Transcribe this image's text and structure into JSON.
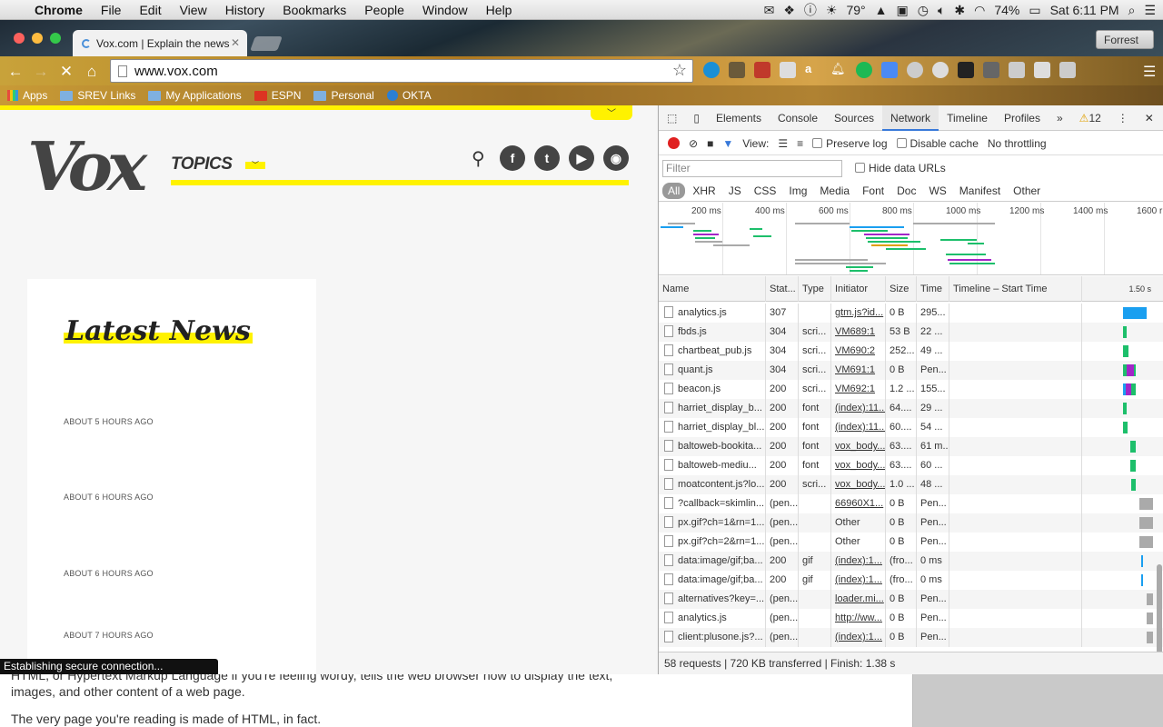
{
  "menubar": {
    "app": "Chrome",
    "items": [
      "File",
      "Edit",
      "View",
      "History",
      "Bookmarks",
      "People",
      "Window",
      "Help"
    ],
    "weather": "79°",
    "battery": "74%",
    "clock": "Sat 6:11 PM"
  },
  "browser": {
    "tab_title": "Vox.com | Explain the news",
    "url": "www.vox.com",
    "user": "Forrest",
    "bookmarks": [
      "Apps",
      "SREV Links",
      "My Applications",
      "ESPN",
      "Personal",
      "OKTA"
    ]
  },
  "page": {
    "logo": "Vox",
    "topics": "TOPICS",
    "latest_news": "Latest News",
    "timestamps": [
      "ABOUT 5 HOURS AGO",
      "ABOUT 6 HOURS AGO",
      "ABOUT 6 HOURS AGO",
      "ABOUT 7 HOURS AGO"
    ],
    "status": "Establishing secure connection...",
    "social": [
      "f",
      "t",
      "▶",
      "◉"
    ]
  },
  "background_doc": {
    "line1": "HTML, or Hypertext Markup Language if you're feeling wordy, tells the web browser how to display the text,",
    "line2": "images, and other content of a web page.",
    "line3": "The very page you're reading is made of HTML, in fact."
  },
  "devtools": {
    "tabs": [
      "Elements",
      "Console",
      "Sources",
      "Network",
      "Timeline",
      "Profiles"
    ],
    "active_tab": "Network",
    "warnings": "12",
    "view_label": "View:",
    "preserve_log": "Preserve log",
    "disable_cache": "Disable cache",
    "throttling": "No throttling",
    "filter_placeholder": "Filter",
    "hide_data_urls": "Hide data URLs",
    "filters": [
      "All",
      "XHR",
      "JS",
      "CSS",
      "Img",
      "Media",
      "Font",
      "Doc",
      "WS",
      "Manifest",
      "Other"
    ],
    "overview_labels": [
      "200 ms",
      "400 ms",
      "600 ms",
      "800 ms",
      "1000 ms",
      "1200 ms",
      "1400 ms",
      "1600 r"
    ],
    "columns": [
      "Name",
      "Stat...",
      "Type",
      "Initiator",
      "Size",
      "Time",
      "Timeline – Start Time"
    ],
    "timeline_scale": "1.50 s",
    "rows": [
      {
        "name": "analytics.js",
        "status": "307",
        "type": "",
        "initiator": "gtm.js?id...",
        "size": "0 B",
        "time": "295...",
        "wf": [
          {
            "s": 0.55,
            "w": 0.35,
            "c": "#1a9ff0"
          }
        ]
      },
      {
        "name": "fbds.js",
        "status": "304",
        "type": "scri...",
        "initiator": "VM689:1",
        "size": "53 B",
        "time": "22 ...",
        "wf": [
          {
            "s": 0.55,
            "w": 0.06,
            "c": "#1dbf6b"
          }
        ]
      },
      {
        "name": "chartbeat_pub.js",
        "status": "304",
        "type": "scri...",
        "initiator": "VM690:2",
        "size": "252...",
        "time": "49 ...",
        "wf": [
          {
            "s": 0.55,
            "w": 0.08,
            "c": "#1dbf6b"
          }
        ]
      },
      {
        "name": "quant.js",
        "status": "304",
        "type": "scri...",
        "initiator": "VM691:1",
        "size": "0 B",
        "time": "Pen...",
        "wf": [
          {
            "s": 0.55,
            "w": 0.06,
            "c": "#1dbf6b"
          },
          {
            "s": 0.61,
            "w": 0.1,
            "c": "#a326c8"
          },
          {
            "s": 0.71,
            "w": 0.04,
            "c": "#1dbf6b"
          }
        ]
      },
      {
        "name": "beacon.js",
        "status": "200",
        "type": "scri...",
        "initiator": "VM692:1",
        "size": "1.2 ...",
        "time": "155...",
        "wf": [
          {
            "s": 0.55,
            "w": 0.04,
            "c": "#1a9ff0"
          },
          {
            "s": 0.59,
            "w": 0.08,
            "c": "#a326c8"
          },
          {
            "s": 0.67,
            "w": 0.08,
            "c": "#1dbf6b"
          }
        ]
      },
      {
        "name": "harriet_display_b...",
        "status": "200",
        "type": "font",
        "initiator": "(index):11...",
        "size": "64....",
        "time": "29 ...",
        "wf": [
          {
            "s": 0.55,
            "w": 0.06,
            "c": "#1dbf6b"
          }
        ]
      },
      {
        "name": "harriet_display_bl...",
        "status": "200",
        "type": "font",
        "initiator": "(index):11...",
        "size": "60....",
        "time": "54 ...",
        "wf": [
          {
            "s": 0.56,
            "w": 0.06,
            "c": "#1dbf6b"
          }
        ]
      },
      {
        "name": "baltoweb-bookita...",
        "status": "200",
        "type": "font",
        "initiator": "vox_body...",
        "size": "63....",
        "time": "61 m...",
        "wf": [
          {
            "s": 0.66,
            "w": 0.09,
            "c": "#1dbf6b"
          }
        ]
      },
      {
        "name": "baltoweb-mediu...",
        "status": "200",
        "type": "font",
        "initiator": "vox_body...",
        "size": "63....",
        "time": "60 ...",
        "wf": [
          {
            "s": 0.66,
            "w": 0.09,
            "c": "#1dbf6b"
          }
        ]
      },
      {
        "name": "moatcontent.js?lo...",
        "status": "200",
        "type": "scri...",
        "initiator": "vox_body...",
        "size": "1.0 ...",
        "time": "48 ...",
        "wf": [
          {
            "s": 0.67,
            "w": 0.08,
            "c": "#1dbf6b"
          }
        ]
      },
      {
        "name": "?callback=skimlin...",
        "status": "(pen...",
        "type": "",
        "initiator": "66960X1...",
        "size": "0 B",
        "time": "Pen...",
        "wf": [
          {
            "s": 0.8,
            "w": 0.2,
            "c": "#aaa"
          }
        ]
      },
      {
        "name": "px.gif?ch=1&rn=1...",
        "status": "(pen...",
        "type": "",
        "initiator": "Other",
        "size": "0 B",
        "time": "Pen...",
        "wf": [
          {
            "s": 0.8,
            "w": 0.2,
            "c": "#aaa"
          }
        ]
      },
      {
        "name": "px.gif?ch=2&rn=1...",
        "status": "(pen...",
        "type": "",
        "initiator": "Other",
        "size": "0 B",
        "time": "Pen...",
        "wf": [
          {
            "s": 0.8,
            "w": 0.2,
            "c": "#aaa"
          }
        ]
      },
      {
        "name": "data:image/gif;ba...",
        "status": "200",
        "type": "gif",
        "initiator": "(index):1...",
        "size": "(fro...",
        "time": "0 ms",
        "wf": [
          {
            "s": 0.82,
            "w": 0.02,
            "c": "#1a9ff0"
          }
        ]
      },
      {
        "name": "data:image/gif;ba...",
        "status": "200",
        "type": "gif",
        "initiator": "(index):1...",
        "size": "(fro...",
        "time": "0 ms",
        "wf": [
          {
            "s": 0.82,
            "w": 0.02,
            "c": "#1a9ff0"
          }
        ]
      },
      {
        "name": "alternatives?key=...",
        "status": "(pen...",
        "type": "",
        "initiator": "loader.mi...",
        "size": "0 B",
        "time": "Pen...",
        "wf": [
          {
            "s": 0.9,
            "w": 0.1,
            "c": "#aaa"
          }
        ]
      },
      {
        "name": "analytics.js",
        "status": "(pen...",
        "type": "",
        "initiator": "http://ww...",
        "size": "0 B",
        "time": "Pen...",
        "wf": [
          {
            "s": 0.9,
            "w": 0.1,
            "c": "#aaa"
          }
        ]
      },
      {
        "name": "client:plusone.js?...",
        "status": "(pen...",
        "type": "",
        "initiator": "(index):1...",
        "size": "0 B",
        "time": "Pen...",
        "wf": [
          {
            "s": 0.9,
            "w": 0.1,
            "c": "#aaa"
          }
        ]
      }
    ],
    "underlined_initiators": [
      true,
      true,
      true,
      true,
      true,
      true,
      true,
      true,
      true,
      true,
      true,
      false,
      false,
      true,
      true,
      true,
      true,
      true
    ],
    "footer": {
      "requests": "58 requests",
      "transferred": "720 KB transferred",
      "finish": "Finish: 1.38 s"
    }
  }
}
